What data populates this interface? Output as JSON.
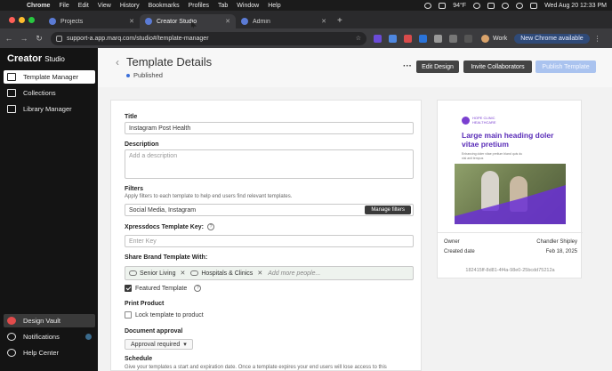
{
  "menubar": {
    "app": "Chrome",
    "items": [
      "File",
      "Edit",
      "View",
      "History",
      "Bookmarks",
      "Profiles",
      "Tab",
      "Window",
      "Help"
    ],
    "temperature": "94°F",
    "datetime": "Wed Aug 20  12:33 PM"
  },
  "tabs": [
    {
      "label": "Projects",
      "active": false
    },
    {
      "label": "Creator Studio",
      "active": true
    },
    {
      "label": "Admin",
      "active": false
    }
  ],
  "addressbar": {
    "url": "support-a.app.marq.com/studio#/template-manager",
    "profile": "Work",
    "new_chrome_label": "New Chrome available"
  },
  "sidebar": {
    "brand": "Creator",
    "brand_sub": "Studio",
    "items": [
      {
        "label": "Template Manager",
        "icon": "template-icon",
        "active": true
      },
      {
        "label": "Collections",
        "icon": "collections-icon",
        "active": false
      },
      {
        "label": "Library Manager",
        "icon": "library-icon",
        "active": false
      }
    ],
    "bottom": [
      {
        "label": "Design Vault",
        "icon": "vault-icon"
      },
      {
        "label": "Notifications",
        "icon": "bell-icon"
      },
      {
        "label": "Help Center",
        "icon": "help-icon"
      }
    ]
  },
  "header": {
    "title": "Template Details",
    "status": "Published",
    "edit_label": "Edit Design",
    "invite_label": "Invite Collaborators",
    "publish_label": "Publish Template"
  },
  "form": {
    "title_label": "Title",
    "title_value": "Instagram Post Health",
    "description_label": "Description",
    "description_placeholder": "Add a description",
    "filters_label": "Filters",
    "filters_hint": "Apply filters to each template to help end users find relevant templates.",
    "filters_value": "Social Media, Instagram",
    "manage_filters_label": "Manage filters",
    "xpress_label": "Xpressdocs Template Key:",
    "xpress_placeholder": "Enter Key",
    "share_label": "Share Brand Template With:",
    "share_chips": [
      "Senior Living",
      "Hospitals & Clinics"
    ],
    "share_placeholder": "Add more people...",
    "featured_label": "Featured Template",
    "print_label": "Print Product",
    "lock_label": "Lock template to product",
    "approval_label": "Document approval",
    "approval_value": "Approval required",
    "schedule_label": "Schedule",
    "schedule_hint": "Give your templates a start and expiration date. Once a template expires your end users will lose access to this"
  },
  "preview": {
    "logo_text": "HOPE CLINIC\nHEALTHCARE",
    "heading": "Large main heading doler vitae pretium",
    "subtext": "Enhancing doler vitae pretium bland quis du nisl anit tempus",
    "owner_label": "Owner",
    "owner_value": "Chandler Shipley",
    "created_label": "Created date",
    "created_value": "Feb 18, 2025",
    "uuid": "182415ff-8d81-4f4a-98e0-25bcdd75212a"
  }
}
